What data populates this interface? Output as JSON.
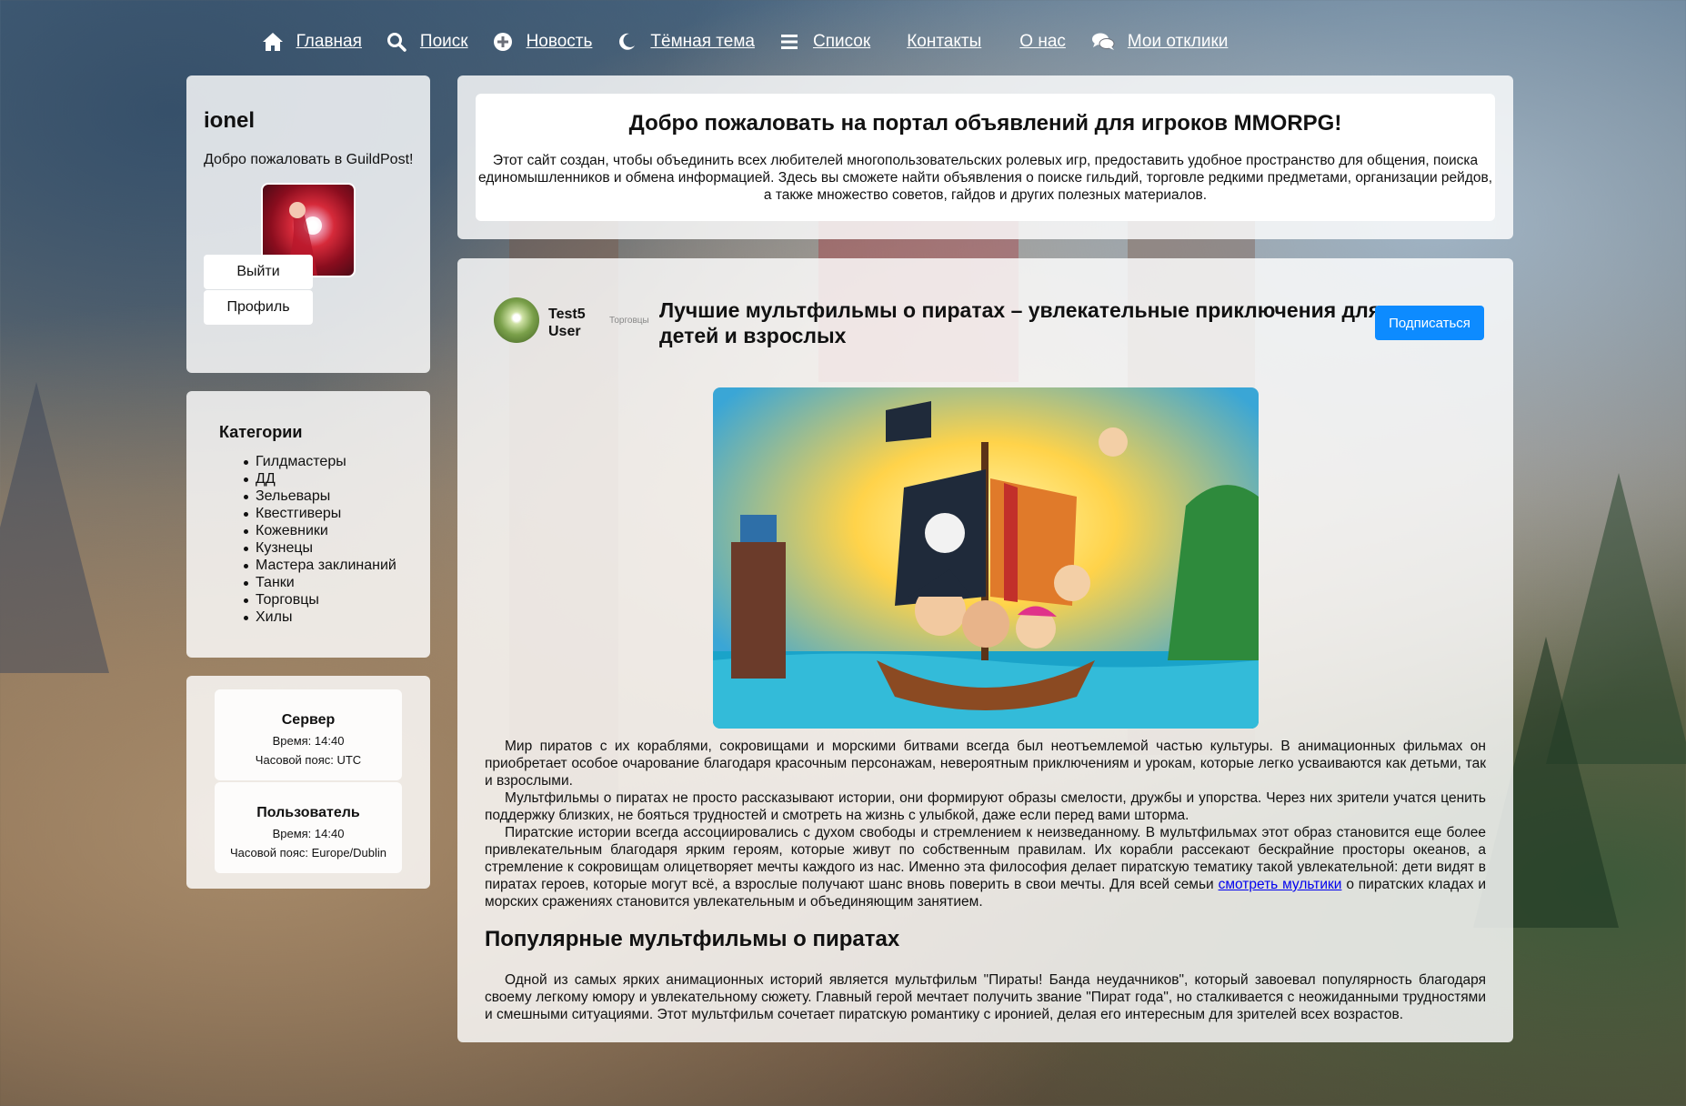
{
  "nav": {
    "items": [
      {
        "label": "Главная",
        "icon": "home-icon"
      },
      {
        "label": "Поиск",
        "icon": "search-icon"
      },
      {
        "label": "Новость",
        "icon": "plus-circle-icon"
      },
      {
        "label": "Тёмная тема",
        "icon": "moon-icon"
      },
      {
        "label": "Список",
        "icon": "list-icon"
      },
      {
        "label": "Контакты",
        "icon": ""
      },
      {
        "label": "О нас",
        "icon": ""
      },
      {
        "label": "Мои отклики",
        "icon": "chat-icon"
      }
    ]
  },
  "user": {
    "name": "ionel",
    "welcome": "Добро пожаловать в GuildPost!",
    "logout_label": "Выйти",
    "profile_label": "Профиль"
  },
  "categories": {
    "title": "Категории",
    "items": [
      "Гилдмастеры",
      "ДД",
      "Зельевары",
      "Квестгиверы",
      "Кожевники",
      "Кузнецы",
      "Мастера заклинаний",
      "Танки",
      "Торговцы",
      "Хилы"
    ]
  },
  "time": {
    "server": {
      "title": "Сервер",
      "time": "Время: 14:40",
      "tz": "Часовой пояс: UTC"
    },
    "user": {
      "title": "Пользователь",
      "time": "Время: 14:40",
      "tz": "Часовой пояс: Europe/Dublin"
    }
  },
  "intro": {
    "title": "Добро пожаловать на портал объявлений для игроков MMORPG!",
    "text": "Этот сайт создан, чтобы объединить всех любителей многопользовательских ролевых игр, предоставить удобное пространство для общения, поиска единомышленников и обмена информацией. Здесь вы сможете найти объявления о поиске гильдий, торговле редкими предметами, организации рейдов, а также множество советов, гайдов и других полезных материалов."
  },
  "post": {
    "author_name": "Test5",
    "author_role": "User",
    "category": "Торговцы",
    "title": "Лучшие мультфильмы о пиратах – увлекательные приключения для детей и взрослых",
    "subscribe_label": "Подписаться",
    "p1": "Мир пиратов с их кораблями, сокровищами и морскими битвами всегда был неотъемлемой частью культуры. В анимационных фильмах он приобретает особое очарование благодаря красочным персонажам, невероятным приключениям и урокам, которые легко усваиваются как детьми, так и взрослыми.",
    "p2": "Мультфильмы о пиратах не просто рассказывают истории, они формируют образы смелости, дружбы и упорства. Через них зрители учатся ценить поддержку близких, не бояться трудностей и смотреть на жизнь с улыбкой, даже если перед вами шторма.",
    "p3_before": "Пиратские истории всегда ассоциировались с духом свободы и стремлением к неизведанному. В мультфильмах этот образ становится еще более привлекательным благодаря ярким героям, которые живут по собственным правилам. Их корабли рассекают бескрайние просторы океанов, а стремление к сокровищам олицетворяет мечты каждого из нас. Именно эта философия делает пиратскую тематику такой увлекательной: дети видят в пиратах героев, которые могут всё, а взрослые получают шанс вновь поверить в свои мечты. Для всей семьи",
    "p3_link": "смотреть мультики",
    "p3_after": "о пиратских кладах и морских сражениях становится увлекательным и объединяющим занятием.",
    "h2": "Популярные мультфильмы о пиратах",
    "p4": "Одной из самых ярких анимационных историй является мультфильм \"Пираты! Банда неудачников\", который завоевал популярность благодаря своему легкому юмору и увлекательному сюжету. Главный герой мечтает получить звание \"Пират года\", но сталкивается с неожиданными трудностями и смешными ситуациями. Этот мультфильм сочетает пиратскую романтику с иронией, делая его интересным для зрителей всех возрастов."
  },
  "colors": {
    "accent": "#0d8bff",
    "link": "#0000ee"
  }
}
